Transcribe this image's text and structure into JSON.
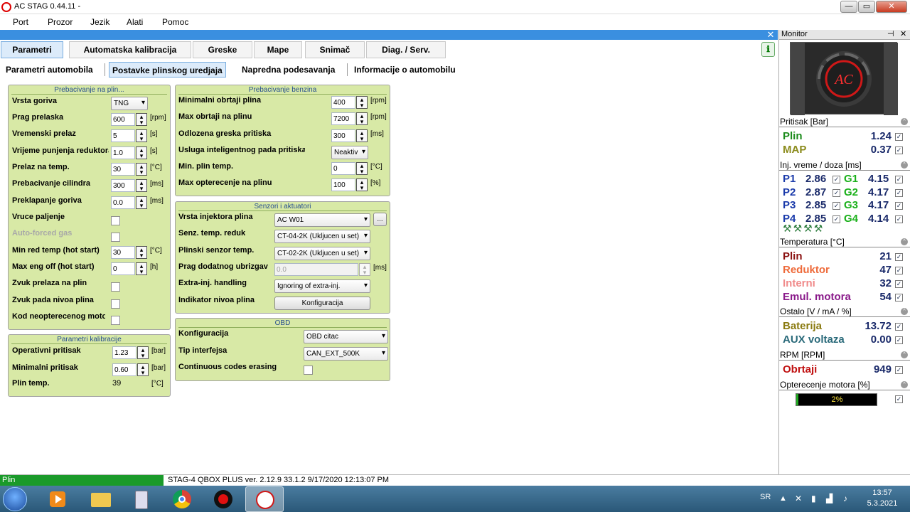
{
  "window": {
    "title": "AC STAG 0.44.11 -",
    "min": "—",
    "max": "▭",
    "close": "✕"
  },
  "menu": [
    "Port",
    "Prozor",
    "Jezik",
    "Alati",
    "Pomoc"
  ],
  "tabs": [
    "Parametri",
    "Automatska kalibracija",
    "Greske",
    "Mape",
    "Snimač",
    "Diag. / Serv."
  ],
  "subtabs": [
    "Parametri automobila",
    "Postavke plinskog uredjaja",
    "Napredna podesavanja",
    "Informacije o automobilu"
  ],
  "panel_close": "✕",
  "help_icon": "ℹ",
  "groups": {
    "prebacivanje_plin": {
      "title": "Prebacivanje na plin...",
      "vrsta_goriva": {
        "label": "Vrsta goriva",
        "value": "TNG"
      },
      "prag_prelaska": {
        "label": "Prag prelaska",
        "value": "600",
        "unit": "[rpm]"
      },
      "vremenski_prelaz": {
        "label": "Vremenski prelaz",
        "value": "5",
        "unit": "[s]"
      },
      "vrijeme_punjenja": {
        "label": "Vrijeme punjenja reduktora",
        "value": "1.0",
        "unit": "[s]"
      },
      "prelaz_temp": {
        "label": "Prelaz na temp.",
        "value": "30",
        "unit": "[°C]"
      },
      "prebacivanje_cilindra": {
        "label": "Prebacivanje cilindra",
        "value": "300",
        "unit": "[ms]"
      },
      "preklapanje_goriva": {
        "label": "Preklapanje goriva",
        "value": "0.0",
        "unit": "[ms]"
      },
      "vruce_paljenje": {
        "label": "Vruce paljenje"
      },
      "auto_forced": {
        "label": "Auto-forced gas"
      },
      "min_red_temp": {
        "label": "Min red temp (hot start)",
        "value": "30",
        "unit": "[°C]"
      },
      "max_eng_off": {
        "label": "Max eng off (hot start)",
        "value": "0",
        "unit": "[h]"
      },
      "zvuk_prelaza": {
        "label": "Zvuk prelaza na plin"
      },
      "zvuk_pada": {
        "label": "Zvuk pada nivoa plina"
      },
      "kod_neopterecenog": {
        "label": "Kod neopterecenog motora"
      }
    },
    "parametri_kalibracije": {
      "title": "Parametri kalibracije",
      "operativni": {
        "label": "Operativni pritisak",
        "value": "1.23",
        "unit": "[bar]"
      },
      "minimalni": {
        "label": "Minimalni pritisak",
        "value": "0.60",
        "unit": "[bar]"
      },
      "plin_temp": {
        "label": "Plin temp.",
        "value": "39",
        "unit": "[°C]"
      }
    },
    "prebacivanje_benzina": {
      "title": "Prebacivanje benzina",
      "min_obrtaji": {
        "label": "Minimalni obrtaji plina",
        "value": "400",
        "unit": "[rpm]"
      },
      "max_obrtaji": {
        "label": "Max obrtaji na plinu",
        "value": "7200",
        "unit": "[rpm]"
      },
      "odlozena": {
        "label": "Odlozena greska pritiska",
        "value": "300",
        "unit": "[ms]"
      },
      "usluga": {
        "label": "Usluga inteligentnog pada pritiska",
        "value": "Neaktiv"
      },
      "min_plin_temp": {
        "label": "Min. plin temp.",
        "value": "0",
        "unit": "[°C]"
      },
      "max_opterecenje": {
        "label": "Max opterecenje na plinu",
        "value": "100",
        "unit": "[%]"
      }
    },
    "senzori": {
      "title": "Senzori i aktuatori",
      "vrsta_injektora": {
        "label": "Vrsta injektora plina",
        "value": "AC W01",
        "btn": "..."
      },
      "senz_temp": {
        "label": "Senz. temp. reduk",
        "value": "CT-04-2K (Ukljucen u set)"
      },
      "plinski_senzor": {
        "label": "Plinski senzor temp.",
        "value": "CT-02-2K (Ukljucen u set)"
      },
      "prag_dodatnog": {
        "label": "Prag dodatnog ubrizgavanja",
        "value": "0.0",
        "unit": "[ms]"
      },
      "extra_inj": {
        "label": "Extra-inj. handling",
        "value": "Ignoring of extra-inj."
      },
      "indikator": {
        "label": "Indikator nivoa plina",
        "btn": "Konfiguracija"
      }
    },
    "obd": {
      "title": "OBD",
      "konfiguracija": {
        "label": "Konfiguracija",
        "value": "OBD citac"
      },
      "tip_interfejsa": {
        "label": "Tip interfejsa",
        "value": "CAN_EXT_500K"
      },
      "continuous": {
        "label": "Continuous codes erasing"
      }
    }
  },
  "monitor": {
    "title": "Monitor",
    "pin": "⊣",
    "close": "✕",
    "logo_text": "AC",
    "pritisak": {
      "title": "Pritisak [Bar]",
      "plin": {
        "label": "Plin",
        "value": "1.24"
      },
      "map": {
        "label": "MAP",
        "value": "0.37"
      }
    },
    "inj": {
      "title": "Inj. vreme / doza [ms]",
      "rows": [
        {
          "p": "P1",
          "pv": "2.86",
          "g": "G1",
          "gv": "4.15"
        },
        {
          "p": "P2",
          "pv": "2.87",
          "g": "G2",
          "gv": "4.17"
        },
        {
          "p": "P3",
          "pv": "2.85",
          "g": "G3",
          "gv": "4.17"
        },
        {
          "p": "P4",
          "pv": "2.85",
          "g": "G4",
          "gv": "4.14"
        }
      ]
    },
    "temperatura": {
      "title": "Temperatura [°C]",
      "rows": [
        {
          "label": "Plin",
          "value": "21",
          "color": "#8a1010"
        },
        {
          "label": "Reduktor",
          "value": "47",
          "color": "#ee6a3a"
        },
        {
          "label": "Interni",
          "value": "32",
          "color": "#f08a8a"
        },
        {
          "label": "Emul. motora",
          "value": "54",
          "color": "#8a1a8a"
        }
      ]
    },
    "ostalo": {
      "title": "Ostalo [V / mA / %]",
      "rows": [
        {
          "label": "Baterija",
          "value": "13.72",
          "color": "#8a7a10"
        },
        {
          "label": "AUX voltaza",
          "value": "0.00",
          "color": "#2a6a7a"
        }
      ]
    },
    "rpm": {
      "title": "RPM [RPM]",
      "obrtaji": {
        "label": "Obrtaji",
        "value": "949",
        "color": "#c01010"
      }
    },
    "opterecenje": {
      "title": "Opterecenje motora [%]",
      "text": "2%",
      "fraction": 0.02
    },
    "collapse": "^",
    "check": "✓"
  },
  "status": {
    "plin": "Plin",
    "info": "STAG-4 QBOX PLUS  ver. 2.12.9  33.1.2   9/17/2020 12:13:07 PM"
  },
  "taskbar": {
    "lang": "SR",
    "time": "13:57",
    "date": "5.3.2021"
  },
  "colors": {
    "group_bg": "#d8e9a6",
    "accent": "#3a8fe0",
    "status_green": "#1a9a2a"
  }
}
